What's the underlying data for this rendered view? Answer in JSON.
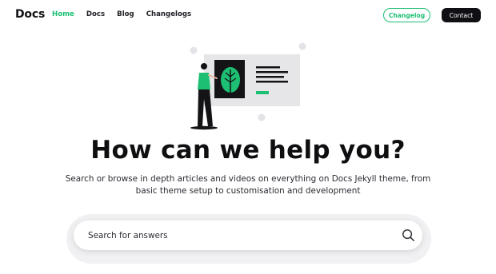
{
  "header": {
    "logo": "Docs",
    "nav": [
      {
        "label": "Home",
        "active": true
      },
      {
        "label": "Docs",
        "active": false
      },
      {
        "label": "Blog",
        "active": false
      },
      {
        "label": "Changelogs",
        "active": false
      }
    ],
    "changelog_button": "Changelog",
    "contact_button": "Contact"
  },
  "hero": {
    "title": "How can we help you?",
    "subtitle_line1": "Search or browse in depth articles and videos on everything on Docs Jekyll theme, from",
    "subtitle_line2": "basic theme setup to customisation and development"
  },
  "search": {
    "placeholder": "Search for answers",
    "icon": "search-icon"
  },
  "colors": {
    "accent": "#1dbf73",
    "dark": "#101014"
  }
}
